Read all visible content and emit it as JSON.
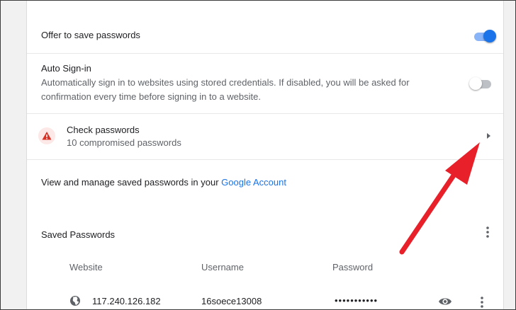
{
  "settings": {
    "offer_save": {
      "label": "Offer to save passwords",
      "enabled": true
    },
    "auto_signin": {
      "label": "Auto Sign-in",
      "description_line1": "Automatically sign in to websites using stored credentials. If disabled, you will be asked for",
      "description_line2": "confirmation every time before signing in to a website.",
      "enabled": false
    },
    "check_passwords": {
      "label": "Check passwords",
      "status": "10 compromised passwords",
      "icon": "warning-triangle-icon"
    },
    "manage": {
      "text": "View and manage saved passwords in your ",
      "link_text": "Google Account"
    }
  },
  "saved_passwords": {
    "title": "Saved Passwords",
    "columns": [
      "Website",
      "Username",
      "Password"
    ],
    "rows": [
      {
        "website": "117.240.126.182",
        "username": "16soece13008",
        "password": "•••••••••••"
      }
    ]
  },
  "colors": {
    "accent": "#1a73e8",
    "warning": "#d93025",
    "annotation_arrow": "#e8202a"
  }
}
